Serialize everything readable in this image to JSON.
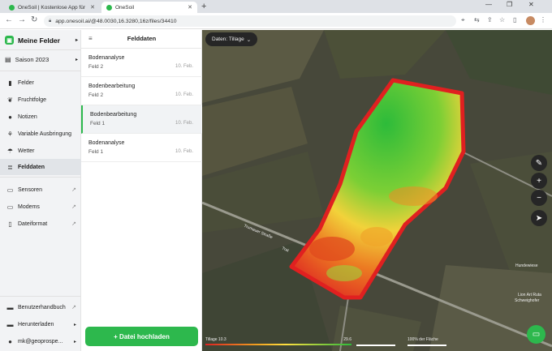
{
  "browser": {
    "tabs": [
      {
        "title": "OneSoil | Kostenlose App für die"
      },
      {
        "title": "OneSoil"
      }
    ],
    "url": "app.onesoil.ai/@48.0030,16.3280,16z/files/34410"
  },
  "nav": {
    "brand": "Meine Felder",
    "season": "Saison 2023",
    "items": [
      {
        "label": "Felder",
        "icon": "bookmark-icon"
      },
      {
        "label": "Fruchtfolge",
        "icon": "leaf-icon"
      },
      {
        "label": "Notizen",
        "icon": "pin-icon"
      },
      {
        "label": "Variable Ausbringung",
        "icon": "sprayer-icon"
      },
      {
        "label": "Wetter",
        "icon": "umbrella-icon"
      },
      {
        "label": "Felddaten",
        "icon": "database-icon"
      }
    ],
    "external": [
      {
        "label": "Sensoren",
        "icon": "sensor-icon"
      },
      {
        "label": "Modems",
        "icon": "modem-icon"
      },
      {
        "label": "Dateiformat",
        "icon": "file-icon"
      }
    ],
    "bottom": [
      {
        "label": "Benutzerhandbuch",
        "icon": "book-icon"
      },
      {
        "label": "Herunterladen",
        "icon": "download-icon"
      },
      {
        "label": "mk@geoprospe...",
        "icon": "user-icon"
      }
    ]
  },
  "panel": {
    "title": "Felddaten",
    "files": [
      {
        "name": "Bodenanalyse",
        "field": "Feld 2",
        "date": "10. Feb."
      },
      {
        "name": "Bodenbearbeitung",
        "field": "Feld 2",
        "date": "10. Feb."
      },
      {
        "name": "Bodenbearbeitung",
        "field": "Feld 1",
        "date": "10. Feb."
      },
      {
        "name": "Bodenanalyse",
        "field": "Feld 1",
        "date": "10. Feb."
      }
    ],
    "upload_label": "+ Datei hochladen"
  },
  "map": {
    "data_selector": "Daten: Tillage",
    "road_label": "Trumauer Straße",
    "road_label_suffix": "Trat",
    "places": [
      "Hundewiese",
      "Lion Art Ruta",
      "Schweighofer"
    ],
    "legend": {
      "min": "Tillage 10.3",
      "max": "29.6",
      "area": "100% der Fläche"
    },
    "colors": {
      "low": "#d22222",
      "mid": "#ffe040",
      "high": "#2dbb3a"
    }
  }
}
